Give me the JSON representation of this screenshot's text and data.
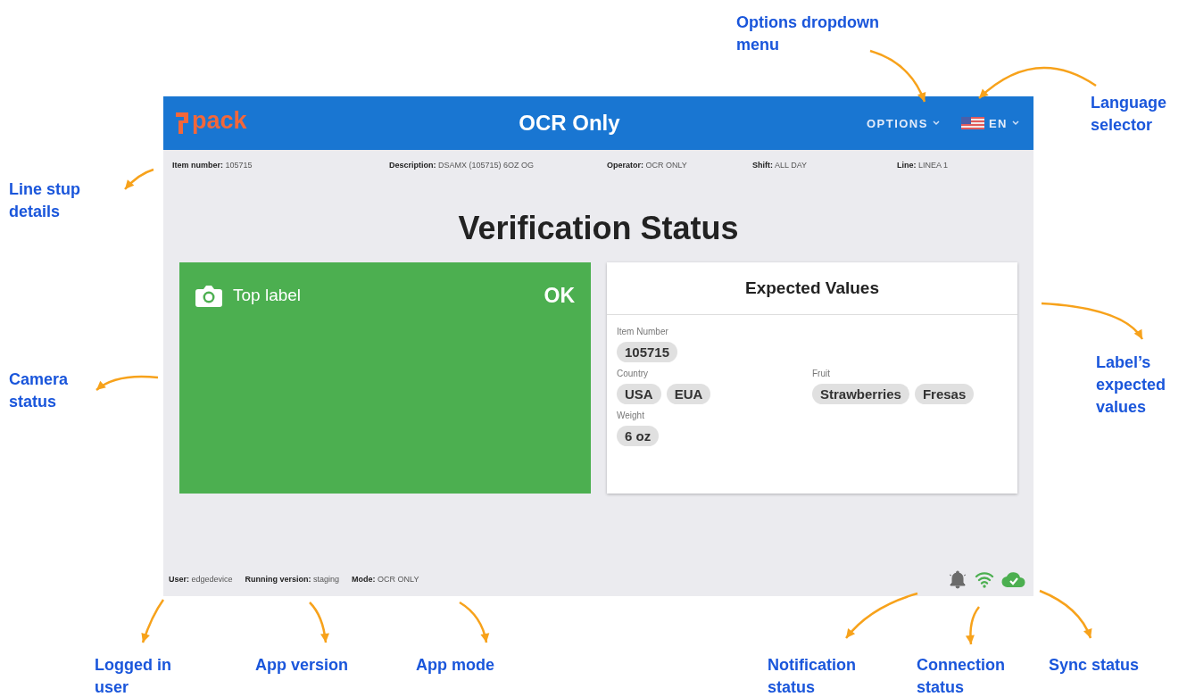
{
  "header": {
    "logo": "pack",
    "title": "OCR Only",
    "options_menu": "OPTIONS",
    "language": "EN"
  },
  "line_details": [
    {
      "label": "Item number:",
      "value": "105715"
    },
    {
      "label": "Description:",
      "value": "DSAMX (105715) 6OZ OG"
    },
    {
      "label": "Operator:",
      "value": "OCR ONLY"
    },
    {
      "label": "Shift:",
      "value": "ALL DAY"
    },
    {
      "label": "Line:",
      "value": "LINEA 1"
    }
  ],
  "heading": "Verification Status",
  "camera": {
    "name": "Top label",
    "status": "OK",
    "passed": true
  },
  "expected_values": {
    "title": "Expected Values",
    "fields": [
      {
        "label": "Item Number",
        "chips": [
          "105715"
        ]
      },
      {
        "label": "Country",
        "chips": [
          "USA",
          "EUA"
        ]
      },
      {
        "label": "Fruit",
        "chips": [
          "Strawberries",
          "Fresas"
        ]
      },
      {
        "label": "Weight",
        "chips": [
          "6 oz"
        ]
      }
    ]
  },
  "footer": [
    {
      "label": "User:",
      "value": "edgedevice"
    },
    {
      "label": "Running version:",
      "value": "staging"
    },
    {
      "label": "Mode:",
      "value": "OCR ONLY"
    }
  ],
  "annotations": [
    "Options dropdown menu",
    "Language selector",
    "Line stup details",
    "Camera status",
    "Label’s expected values",
    "Logged in user",
    "App version",
    "App mode",
    "Notification status",
    "Connection status",
    "Sync status"
  ]
}
